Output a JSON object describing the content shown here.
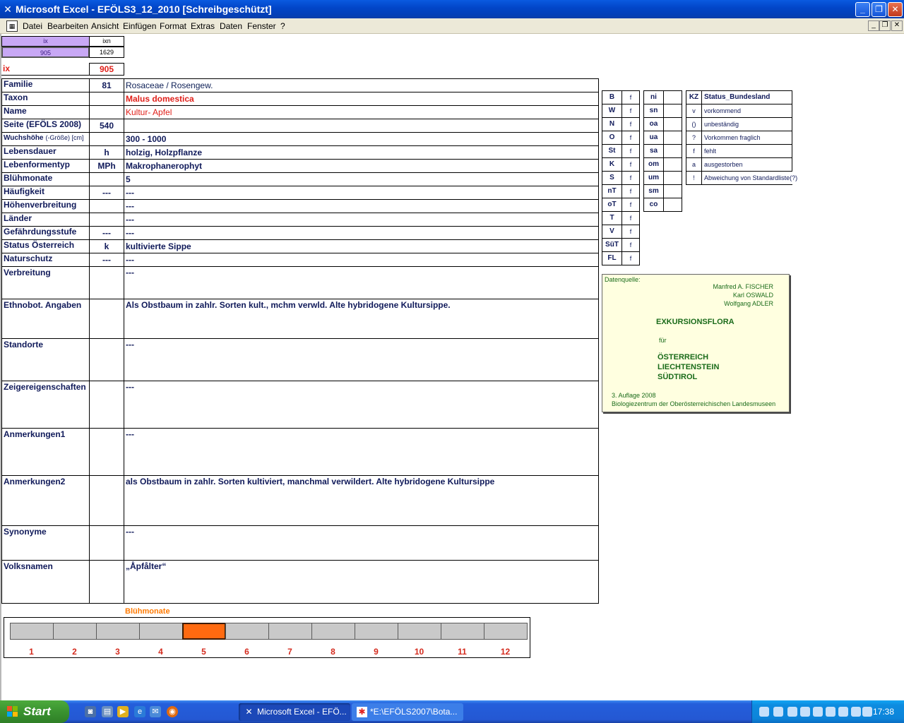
{
  "window": {
    "title": "Microsoft Excel - EFÖLS3_12_2010  [Schreibgeschützt]",
    "menu": [
      "Datei",
      "Bearbeiten",
      "Ansicht",
      "Einfügen",
      "Format",
      "Extras",
      "Daten",
      "Fenster",
      "?"
    ]
  },
  "header": {
    "ix_label": "ix",
    "ixn_label": "ixn",
    "ix_value": "905",
    "ixn_value": "1629",
    "ix_big_label": "ix",
    "ix_big_value": "905"
  },
  "rows": [
    {
      "label": "Familie",
      "code": "81",
      "value": "Rosaceae  /  Rosengew."
    },
    {
      "label": "Taxon",
      "code": "",
      "value": "Malus domestica"
    },
    {
      "label": "Name",
      "code": "",
      "value": "Kultur- Apfel"
    },
    {
      "label": "Seite (EFÖLS 2008)",
      "code": "540",
      "value": ""
    },
    {
      "label": "Wuchshöhe",
      "label_suffix": "(-Größe) [cm]",
      "code": "",
      "value": " 300 - 1000"
    },
    {
      "label": "Lebensdauer",
      "code": "h",
      "value": "holzig, Holzpflanze"
    },
    {
      "label": "Lebenformentyp",
      "code": "MPh",
      "value": "Makrophanerophyt"
    },
    {
      "label": "Blühmonate",
      "code": "",
      "value": " 5"
    },
    {
      "label": "Häufigkeit",
      "code": "---",
      "value": " ---"
    },
    {
      "label": "Höhenverbreitung",
      "code": "",
      "value": " ---"
    },
    {
      "label": "Länder",
      "code": "",
      "value": " ---"
    },
    {
      "label": "Gefährdungsstufe",
      "code": "---",
      "value": "  ---"
    },
    {
      "label": "Status Österreich",
      "code": "k",
      "value": "kultivierte Sippe"
    },
    {
      "label": "Naturschutz",
      "code": "---",
      "value": " ---"
    }
  ],
  "tall_rows": [
    {
      "label": "Verbreitung",
      "value": " ---"
    },
    {
      "label": "Ethnobot. Angaben",
      "value": "Als Obstbaum in zahlr. Sorten kult., mchm verwld. Alte hybridogene Kultursippe."
    },
    {
      "label": "Standorte",
      "value": "---"
    },
    {
      "label": "Zeigereigenschaften",
      "value": "---"
    },
    {
      "label": "Anmerkungen1",
      "value": "---"
    },
    {
      "label": "Anmerkungen2",
      "value": "als Obstbaum in zahlr. Sorten kultiviert, manchmal verwildert. Alte hybridogene Kultursippe"
    },
    {
      "label": "Synonyme",
      "value": "---"
    },
    {
      "label": "Volksnamen",
      "value": " „Åpfålter“"
    }
  ],
  "regions_left": [
    {
      "code": "B",
      "val": "f"
    },
    {
      "code": "W",
      "val": "f"
    },
    {
      "code": "N",
      "val": "f"
    },
    {
      "code": "O",
      "val": "f"
    },
    {
      "code": "St",
      "val": "f"
    },
    {
      "code": "K",
      "val": "f"
    },
    {
      "code": "S",
      "val": "f"
    },
    {
      "code": "nT",
      "val": "f"
    },
    {
      "code": "oT",
      "val": "f"
    },
    {
      "code": "T",
      "val": "f"
    },
    {
      "code": "V",
      "val": "f"
    },
    {
      "code": "SüT",
      "val": "f"
    },
    {
      "code": "FL",
      "val": "f"
    }
  ],
  "regions_right": [
    "ni",
    "sn",
    "oa",
    "ua",
    "sa",
    "om",
    "um",
    "sm",
    "co"
  ],
  "legend": {
    "kz_label": "KZ",
    "title": "Status_Bundesland",
    "items": [
      {
        "kz": "v",
        "text": "vorkommend"
      },
      {
        "kz": "()",
        "text": "unbeständig"
      },
      {
        "kz": "?",
        "text": "Vorkommen fraglich"
      },
      {
        "kz": "f",
        "text": "fehlt"
      },
      {
        "kz": "a",
        "text": "ausgestorben"
      },
      {
        "kz": "!",
        "text": "Abweichung von Standardliste(?)"
      }
    ]
  },
  "source": {
    "label": "Datenquelle:",
    "authors": [
      "Manfred A. FISCHER",
      "Karl OSWALD",
      "Wolfgang ADLER"
    ],
    "book": "EXKURSIONSFLORA",
    "fuer": "für",
    "countries": [
      "ÖSTERREICH",
      "LIECHTENSTEIN",
      "SÜDTIROL"
    ],
    "edition": "3. Auflage 2008",
    "publisher": "Biologiezentrum der Oberösterreichischen Landesmuseen"
  },
  "bloom": {
    "title": "Blühmonate",
    "months": [
      "1",
      "2",
      "3",
      "4",
      "5",
      "6",
      "7",
      "8",
      "9",
      "10",
      "11",
      "12"
    ],
    "active": [
      5
    ],
    "active_color": "#ff6a10",
    "inactive_color": "#c9c9c9"
  },
  "taskbar": {
    "start": "Start",
    "items": [
      "Microsoft Excel - EFÖ...",
      "*E:\\EFÖLS2007\\Bota..."
    ],
    "clock": "17:38"
  }
}
